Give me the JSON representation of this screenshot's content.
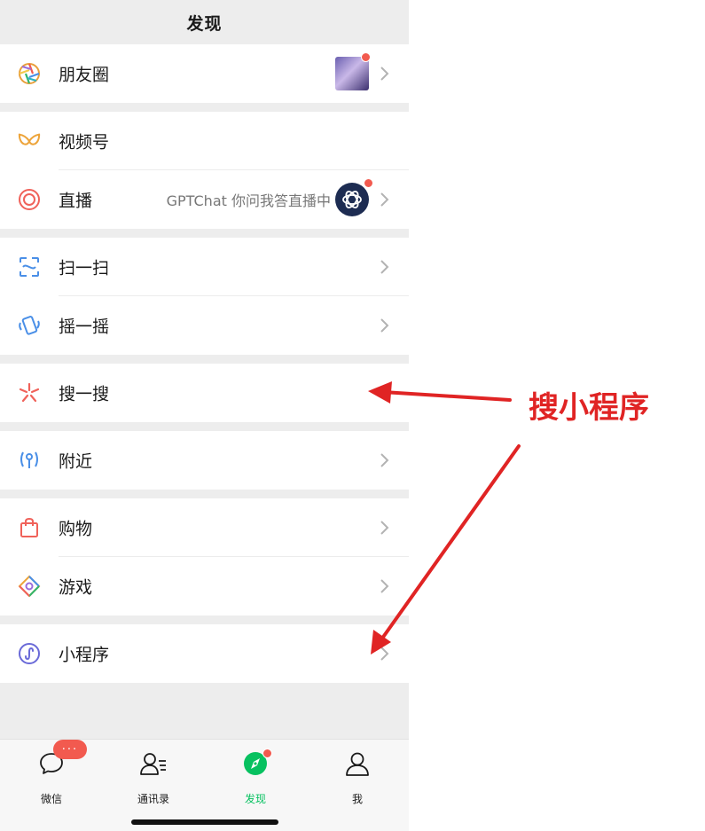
{
  "header": {
    "title": "发现"
  },
  "menu": {
    "moments": {
      "label": "朋友圈",
      "icon": "moments-aperture-icon"
    },
    "channels": {
      "label": "视频号",
      "icon": "channels-icon"
    },
    "live": {
      "label": "直播",
      "extra": "GPTChat 你问我答直播中",
      "icon": "live-icon"
    },
    "scan": {
      "label": "扫一扫",
      "icon": "scan-icon"
    },
    "shake": {
      "label": "摇一摇",
      "icon": "shake-icon"
    },
    "search": {
      "label": "搜一搜",
      "icon": "search-sparkle-icon"
    },
    "nearby": {
      "label": "附近",
      "icon": "nearby-icon"
    },
    "shopping": {
      "label": "购物",
      "icon": "shopping-bag-icon"
    },
    "games": {
      "label": "游戏",
      "icon": "games-icon"
    },
    "miniprograms": {
      "label": "小程序",
      "icon": "mini-program-icon"
    }
  },
  "tabbar": {
    "chats": {
      "label": "微信",
      "badge": "···"
    },
    "contacts": {
      "label": "通讯录"
    },
    "discover": {
      "label": "发现"
    },
    "me": {
      "label": "我"
    }
  },
  "annotation": {
    "text": "搜小程序",
    "color": "#e02424"
  },
  "colors": {
    "accent_green": "#07c160",
    "badge_red": "#f25a4f"
  }
}
